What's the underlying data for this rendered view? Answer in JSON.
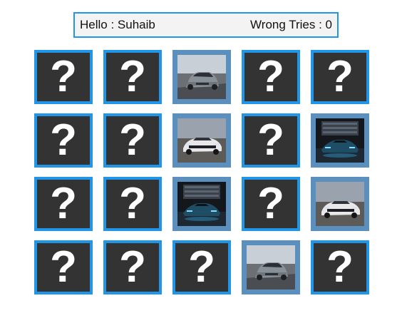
{
  "header": {
    "greeting": "Hello : Suhaib",
    "wrong_tries": "Wrong Tries : 0"
  },
  "cards": [
    {
      "state": "hidden",
      "label": "?"
    },
    {
      "state": "hidden",
      "label": "?"
    },
    {
      "state": "revealed",
      "image": "silver-suv-image"
    },
    {
      "state": "hidden",
      "label": "?"
    },
    {
      "state": "hidden",
      "label": "?"
    },
    {
      "state": "hidden",
      "label": "?"
    },
    {
      "state": "hidden",
      "label": "?"
    },
    {
      "state": "revealed",
      "image": "white-muscle-car-image"
    },
    {
      "state": "hidden",
      "label": "?"
    },
    {
      "state": "revealed",
      "image": "blue-supercar-garage-image"
    },
    {
      "state": "hidden",
      "label": "?"
    },
    {
      "state": "hidden",
      "label": "?"
    },
    {
      "state": "revealed",
      "image": "blue-supercar-garage-image"
    },
    {
      "state": "hidden",
      "label": "?"
    },
    {
      "state": "revealed",
      "image": "white-muscle-car-image"
    },
    {
      "state": "hidden",
      "label": "?"
    },
    {
      "state": "hidden",
      "label": "?"
    },
    {
      "state": "hidden",
      "label": "?"
    },
    {
      "state": "revealed",
      "image": "silver-suv-image"
    },
    {
      "state": "hidden",
      "label": "?"
    }
  ],
  "colors": {
    "card_border": "#2196e8",
    "card_back": "#333333",
    "revealed_frame": "#5b8fbd"
  }
}
